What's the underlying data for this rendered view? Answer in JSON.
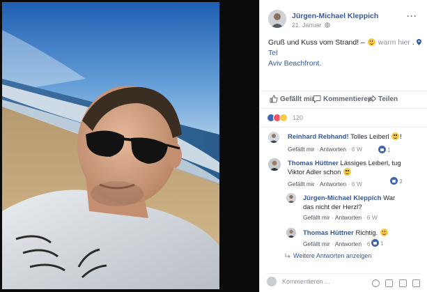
{
  "post": {
    "author": "Jürgen-Michael Kleppich",
    "date": "21. Januar",
    "more_label": "···",
    "text": "Gruß und Kuss vom Strand! –",
    "feeling": "warm hier",
    "location_sep": ".",
    "location": "Tel Aviv Beachfront",
    "location_short": "Tel",
    "location_rest": "Aviv Beachfront."
  },
  "actions": {
    "like": "Gefällt mir",
    "comment": "Kommentieren",
    "share": "Teilen"
  },
  "reactions": {
    "count": "120",
    "colors": {
      "like": "#4267b2",
      "love": "#f25268",
      "haha": "#f7c948"
    }
  },
  "comments": [
    {
      "author": "Reinhard Rebhand!",
      "text": "Tolles Leiberl",
      "like_label": "Gefällt mir",
      "reply_label": "Antworten",
      "sep": "·",
      "age": "6 W",
      "likes": "1"
    },
    {
      "author": "Thomas Hüttner",
      "text": "Lässiges Leiberl, tug Viktor Adler schon",
      "like_label": "Gefällt mir",
      "reply_label": "Antworten",
      "sep": "·",
      "age": "6 W",
      "likes": "3"
    },
    {
      "author": "Jürgen-Michael Kleppich",
      "text": "War das nicht der Herzl?",
      "like_label": "Gefällt mir",
      "reply_label": "Antworten",
      "sep": "·",
      "age": "6 W"
    },
    {
      "author": "Thomas Hüttner",
      "text": "Richtig.",
      "like_label": "Gefällt mir",
      "reply_label": "Antworten",
      "sep": "·",
      "age": "6 W",
      "likes": "1"
    }
  ],
  "more_replies": "Weitere Antworten anzeigen",
  "composer": {
    "placeholder": "Kommentieren ..."
  },
  "colors": {
    "link": "#365899",
    "secondary": "#90949c",
    "viewer_bg": "#0b0b0b"
  }
}
